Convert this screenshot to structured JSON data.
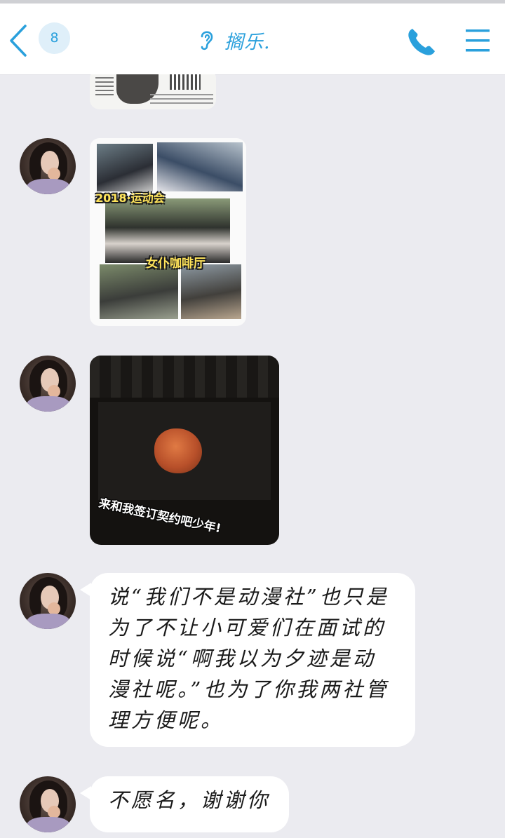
{
  "header": {
    "unread_count": "8",
    "title": "搁乐.",
    "back_icon": "chevron-left-icon",
    "ear_icon": "ear-icon",
    "call_icon": "phone-icon",
    "menu_icon": "hamburger-menu-icon",
    "accent_color": "#2aa0dc"
  },
  "messages": [
    {
      "type": "image",
      "caption": ""
    },
    {
      "type": "image",
      "captions": [
        "2018·运动会",
        "女仆咖啡厅"
      ]
    },
    {
      "type": "image",
      "caption": "来和我签订契约吧少年!"
    },
    {
      "type": "text",
      "text": "说“我们不是动漫社”也只是为了不让小可爱们在面试的时候说“啊我以为夕迹是动漫社呢。”也为了你我两社管理方便呢。"
    },
    {
      "type": "text",
      "text": "不愿名，谢谢你"
    }
  ]
}
